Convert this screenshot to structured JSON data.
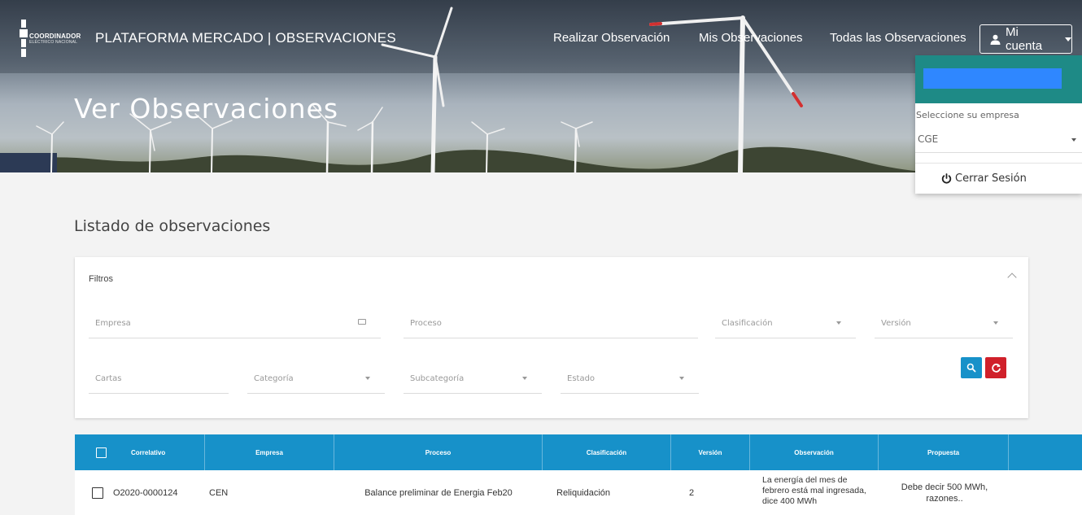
{
  "brand": {
    "line1": "COORDINADOR",
    "line2": "ELÉCTRICO NACIONAL",
    "title": "PLATAFORMA MERCADO | OBSERVACIONES"
  },
  "nav": {
    "realizar": "Realizar Observación",
    "mis": "Mis Observaciones",
    "todas": "Todas las Observaciones",
    "account": "Mi cuenta"
  },
  "hero": {
    "heading": "Ver Observaciones"
  },
  "account_menu": {
    "company_label": "Seleccione su empresa",
    "company_value": "CGE",
    "logout": "Cerrar Sesión"
  },
  "list": {
    "title": "Listado de observaciones"
  },
  "filters": {
    "title": "Filtros",
    "empresa": "Empresa",
    "proceso": "Proceso",
    "clasificacion": "Clasificación",
    "version": "Versión",
    "cartas": "Cartas",
    "categoria": "Categoría",
    "subcategoria": "Subcategoría",
    "estado": "Estado"
  },
  "table": {
    "headers": [
      "Correlativo",
      "Empresa",
      "Proceso",
      "Clasificación",
      "Versión",
      "Observación",
      "Propuesta"
    ],
    "rows": [
      {
        "correlativo": "O2020-0000124",
        "empresa": "CEN",
        "proceso": "Balance preliminar de Energia Feb20",
        "clasificacion": "Reliquidación",
        "version": "2",
        "observacion": "La energía del mes de febrero está mal ingresada, dice 400 MWh",
        "propuesta": "Debe decir 500 MWh, razones.."
      }
    ]
  },
  "colors": {
    "primary": "#1791c9",
    "danger": "#d0202a",
    "teal": "#1e8a86"
  }
}
